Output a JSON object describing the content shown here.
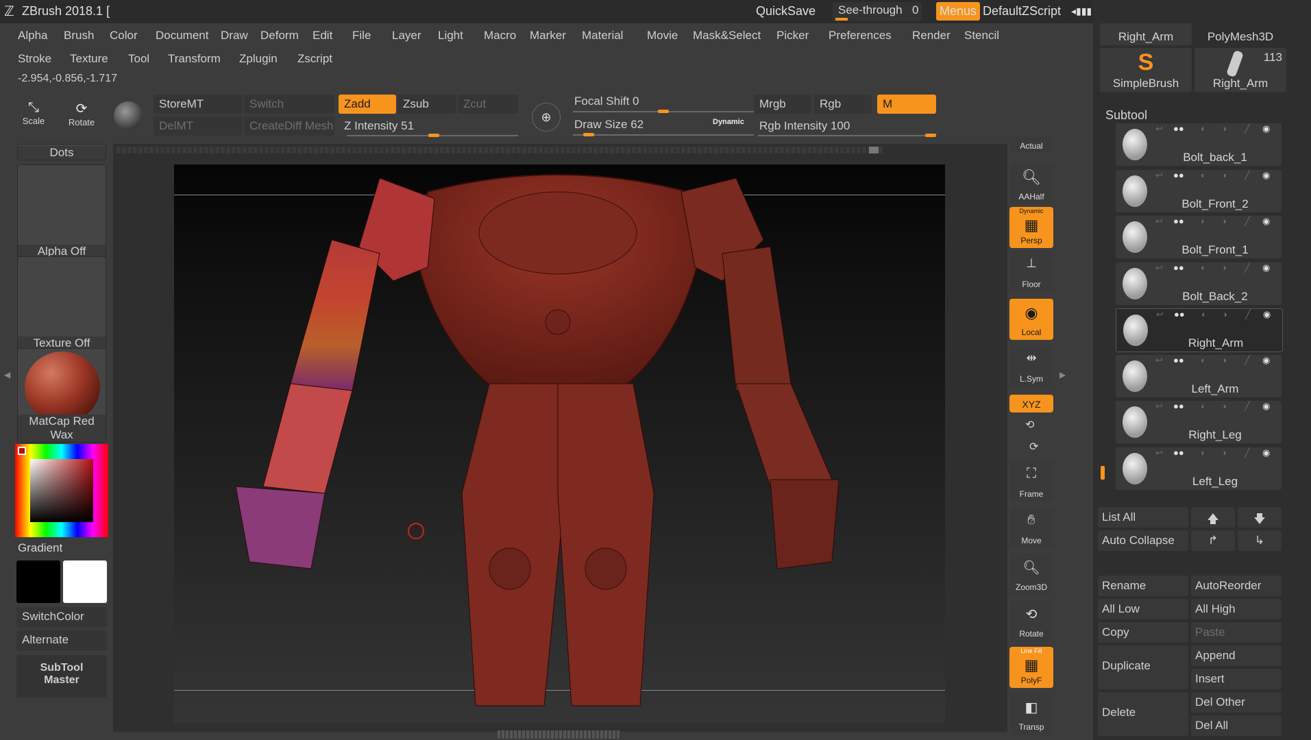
{
  "app": {
    "title": "ZBrush 2018.1 ["
  },
  "titlebar": {
    "quicksave": "QuickSave",
    "seethrough_label": "See-through",
    "seethrough_value": "0",
    "menus": "Menus",
    "script": "DefaultZScript"
  },
  "menu": {
    "row1": [
      "Alpha",
      "Brush",
      "Color",
      "Document",
      "Draw",
      "Deform",
      "Edit",
      "File",
      "Layer",
      "Light",
      "Macro",
      "Marker",
      "Material",
      "Movie",
      "Mask&Select",
      "Picker",
      "Preferences",
      "Render",
      "Stencil"
    ],
    "row2": [
      "Stroke",
      "Texture",
      "Tool",
      "Transform",
      "Zplugin",
      "Zscript"
    ]
  },
  "coords": "-2.954,-0.856,-1.717",
  "toolbar": {
    "scale": "Scale",
    "rotate": "Rotate",
    "storemt": "StoreMT",
    "switch": "Switch",
    "delmt": "DelMT",
    "creatediff": "CreateDiff Mesh",
    "zadd": "Zadd",
    "zsub": "Zsub",
    "zcut": "Zcut",
    "z_intensity_label": "Z Intensity",
    "z_intensity_value": "51",
    "focal_shift_label": "Focal Shift",
    "focal_shift_value": "0",
    "draw_size_label": "Draw Size",
    "draw_size_value": "62",
    "dynamic": "Dynamic",
    "mrgb": "Mrgb",
    "rgb": "Rgb",
    "m": "M",
    "rgb_intensity_label": "Rgb Intensity",
    "rgb_intensity_value": "100"
  },
  "sliders": {
    "z_intensity": 0.51,
    "focal_shift": 0.5,
    "draw_size": 0.06,
    "rgb_intensity": 1.0
  },
  "leftshelf": {
    "dots": "Dots",
    "alpha": "Alpha Off",
    "texture": "Texture Off",
    "material": "MatCap Red Wax",
    "gradient": "Gradient",
    "switchcolor": "SwitchColor",
    "alternate": "Alternate",
    "subtool_master": "SubTool Master"
  },
  "rightshelf": {
    "actual": "Actual",
    "aahalf": "AAHalf",
    "persp": "Persp",
    "persp_top": "Dynamic",
    "floor": "Floor",
    "local": "Local",
    "lsym": "L.Sym",
    "xyz": "XYZ",
    "frame": "Frame",
    "move": "Move",
    "zoom3d": "Zoom3D",
    "rotate": "Rotate",
    "polyf": "PolyF",
    "polyf_top": "Line Fill",
    "transp": "Transp"
  },
  "toolpanel": {
    "thumbs": [
      "Right_Arm",
      "PolyMesh3D",
      "SimpleBrush",
      "Right_Arm"
    ],
    "count": "113",
    "subtool_header": "Subtool",
    "subtools": [
      "Bolt_back_1",
      "Bolt_Front_2",
      "Bolt_Front_1",
      "Bolt_Back_2",
      "Right_Arm",
      "Left_Arm",
      "Right_Leg",
      "Left_Leg"
    ],
    "selected_index": 4,
    "list_all": "List All",
    "auto_collapse": "Auto Collapse",
    "rename": "Rename",
    "autoreorder": "AutoReorder",
    "all_low": "All Low",
    "all_high": "All High",
    "copy": "Copy",
    "paste": "Paste",
    "duplicate": "Duplicate",
    "append": "Append",
    "insert": "Insert",
    "delete": "Delete",
    "del_other": "Del Other",
    "del_all": "Del All"
  },
  "colors": {
    "accent": "#f7941d",
    "model": "#8e2e22",
    "bg": "#3c3c3c"
  }
}
